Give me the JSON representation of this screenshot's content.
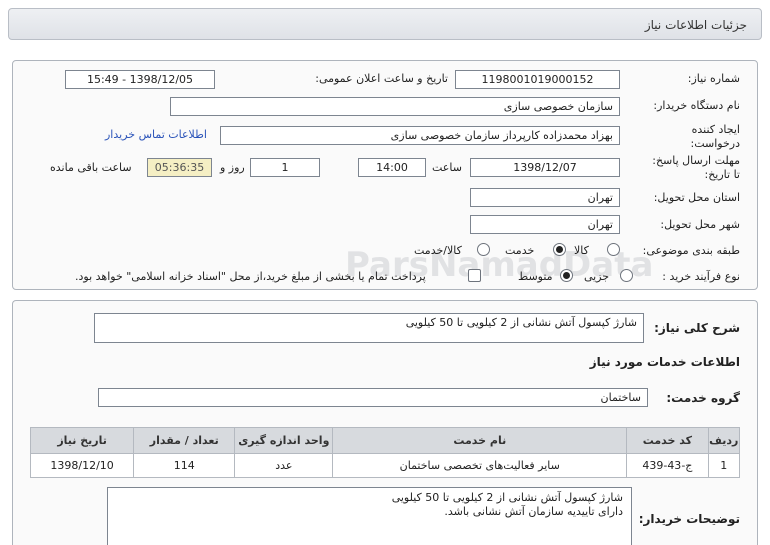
{
  "header": {
    "title": "جزئیات اطلاعات نیاز"
  },
  "form": {
    "need_number": {
      "label": "شماره نیاز:",
      "value": "1198001019000152"
    },
    "announce_datetime": {
      "label": "تاریخ و ساعت اعلان عمومی:",
      "value": "1398/12/05 - 15:49"
    },
    "buyer_org": {
      "label": "نام دستگاه خریدار:",
      "value": "سازمان خصوصی سازی"
    },
    "requester": {
      "label_line1": "ایجاد کننده",
      "label_line2": "درخواست:",
      "value": "بهزاد محمدزاده کارپرداز سازمان خصوصی سازی"
    },
    "contact_link": "اطلاعات تماس خریدار",
    "deadline": {
      "label_line1": "مهلت ارسال پاسخ:",
      "label_line2": "تا تاریخ:",
      "date": "1398/12/07",
      "time_label": "ساعت",
      "time": "14:00",
      "days": "1",
      "days_label": "روز و",
      "remaining": "05:36:35",
      "remaining_label": "ساعت باقی مانده"
    },
    "province": {
      "label": "استان محل تحویل:",
      "value": "تهران"
    },
    "city": {
      "label": "شهر محل تحویل:",
      "value": "تهران"
    },
    "category": {
      "label": "طبقه بندی موضوعی:",
      "options": [
        "کالا",
        "خدمت",
        "کالا/خدمت"
      ],
      "selected": 1
    },
    "process": {
      "label": "نوع فرآیند خرید :",
      "options": [
        "جزیی",
        "متوسط"
      ],
      "selected": 1,
      "payment_note": "پرداخت تمام یا بخشی از مبلغ خرید،از محل \"اسناد خزانه اسلامی\" خواهد بود."
    }
  },
  "need_desc": {
    "label": "شرح کلی نیاز:",
    "value": "شارژ کپسول آتش نشانی از 2 کیلویی تا 50 کیلویی"
  },
  "services_title": "اطلاعات خدمات مورد نیاز",
  "service_group": {
    "label": "گروه خدمت:",
    "value": "ساختمان"
  },
  "table": {
    "headers": [
      "ردیف",
      "کد خدمت",
      "نام خدمت",
      "واحد اندازه گیری",
      "تعداد / مقدار",
      "تاریخ نیاز"
    ],
    "rows": [
      [
        "1",
        "ج-43-439",
        "سایر فعالیت‌های تخصصی ساختمان",
        "عدد",
        "114",
        "1398/12/10"
      ]
    ]
  },
  "buyer_notes": {
    "label": "توضیحات خریدار:",
    "value": "شارژ کپسول آتش نشانی از 2 کیلویی تا 50 کیلویی\nدارای تاییدیه سازمان آتش نشانی باشد."
  },
  "watermark": {
    "brand": "ParsNamadData",
    "tag1": "مرکز فراوری اطلاعات پارس نماد داده ها",
    "tag2": "پایگاه اطلاع رسانی مناقصه ومزایده",
    "phone": "۰۲۱-۸۸۳۴۹۶۷۰-۵"
  }
}
